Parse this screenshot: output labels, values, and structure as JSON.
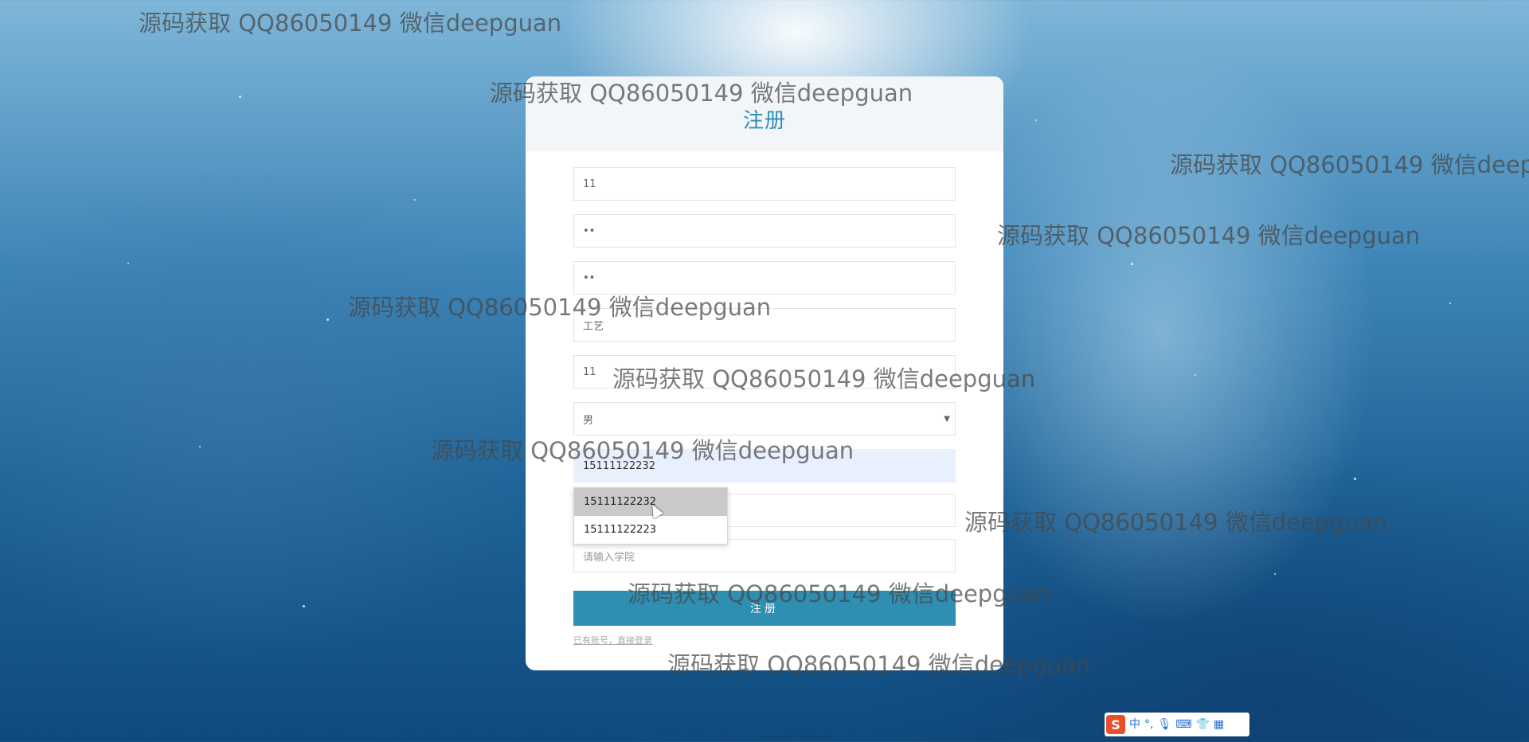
{
  "register": {
    "title": "注册",
    "fields": [
      {
        "value": "11"
      },
      {
        "value": "••"
      },
      {
        "value": "••"
      },
      {
        "value": "工艺"
      },
      {
        "value": "11"
      }
    ],
    "gender_select": {
      "value": "男"
    },
    "phone_field": {
      "value": "15111122232"
    },
    "college_field": {
      "placeholder": "请输入学院"
    },
    "submit_label": "注册",
    "login_link": "已有账号，直接登录"
  },
  "autocomplete": {
    "items": [
      "15111122232",
      "15111122223"
    ]
  },
  "watermark_text": "源码获取 QQ86050149 微信deepguan",
  "ime": {
    "logo": "S",
    "lang": "中",
    "punct": "°,",
    "icons": [
      "microphone-icon",
      "keyboard-icon",
      "shirt-icon",
      "grid-icon"
    ]
  }
}
